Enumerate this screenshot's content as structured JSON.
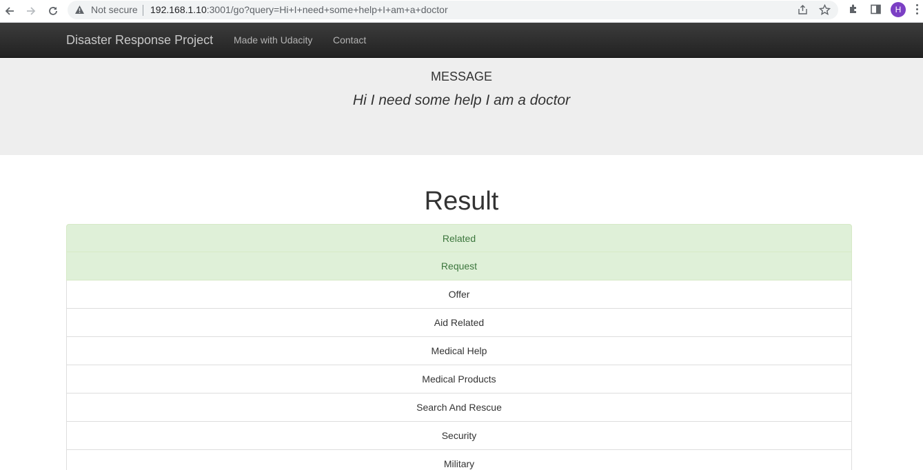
{
  "browser": {
    "security_label": "Not secure",
    "url_host": "192.168.1.10",
    "url_rest": ":3001/go?query=Hi+I+need+some+help+I+am+a+doctor",
    "profile_initial": "H"
  },
  "navbar": {
    "brand": "Disaster Response Project",
    "links": [
      "Made with Udacity",
      "Contact"
    ]
  },
  "jumbotron": {
    "label": "MESSAGE",
    "message": "Hi I need some help I am a doctor"
  },
  "result": {
    "title": "Result",
    "categories": [
      {
        "label": "Related",
        "matched": true
      },
      {
        "label": "Request",
        "matched": true
      },
      {
        "label": "Offer",
        "matched": false
      },
      {
        "label": "Aid Related",
        "matched": false
      },
      {
        "label": "Medical Help",
        "matched": false
      },
      {
        "label": "Medical Products",
        "matched": false
      },
      {
        "label": "Search And Rescue",
        "matched": false
      },
      {
        "label": "Security",
        "matched": false
      },
      {
        "label": "Military",
        "matched": false
      }
    ]
  },
  "colors": {
    "matched_bg": "#dff0d8",
    "matched_text": "#3c763d",
    "navbar_bg": "#222222",
    "jumbotron_bg": "#eeeeee"
  }
}
